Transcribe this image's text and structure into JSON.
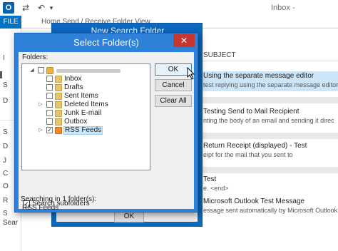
{
  "outlook": {
    "logo": "O",
    "title": "Inbox -",
    "file_tab": "FILE",
    "ribbon_tabs": "Home   Send / Receive   Folder   View",
    "left_nav": [
      "I",
      "S",
      "D",
      "S",
      "D",
      "J",
      "C",
      "O",
      "R",
      "S"
    ],
    "search_nav": "Sear",
    "list_header": "SUBJECT",
    "messages": [
      {
        "subject": "Using the separate message editor",
        "preview": "test replying using the separate message editor",
        "selected": true
      },
      {
        "subject": "Testing Send to Mail Recipient",
        "preview": "nting the body of an email and sending it direc",
        "selected": false
      },
      {
        "subject": "Return Receipt (displayed) - Test",
        "preview": "eipt for the mail that you sent to",
        "selected": false
      },
      {
        "subject": "Test",
        "preview": "e. <end>",
        "selected": false
      },
      {
        "subject": "Microsoft Outlook Test Message",
        "preview": "essage sent automatically by Microsoft Outlook w",
        "selected": false
      }
    ]
  },
  "new_search_folder": {
    "title": "New Search Folder",
    "ok_label": "OK"
  },
  "select_folder": {
    "title": "Select Folder(s)",
    "close_glyph": "✕",
    "folders_label": "Folders:",
    "tree": [
      {
        "label": "Inbox",
        "icon": "folder-icon",
        "checked": false
      },
      {
        "label": "Drafts",
        "icon": "drafts-icon",
        "checked": false
      },
      {
        "label": "Sent Items",
        "icon": "folder-icon",
        "checked": false
      },
      {
        "label": "Deleted Items",
        "icon": "folder-icon",
        "checked": false
      },
      {
        "label": "Junk E-mail",
        "icon": "junk-icon",
        "checked": false
      },
      {
        "label": "Outbox",
        "icon": "outbox-icon",
        "checked": false
      },
      {
        "label": "RSS Feeds",
        "icon": "rss-icon",
        "checked": true
      }
    ],
    "ok_label": "OK",
    "cancel_label": "Cancel",
    "clear_all_label": "Clear All",
    "search_subfolders_label": "Search subfolders",
    "search_subfolders_checked": true,
    "searching_label": "Searching in 1 folder(s):",
    "searching_value": "RSS Feeds"
  },
  "colors": {
    "dialog_active": "#2e80d9",
    "dialog_inactive": "#0d68bf",
    "close_button": "#c7372f",
    "file_tab": "#0072c6",
    "selection": "#cce8ff"
  }
}
